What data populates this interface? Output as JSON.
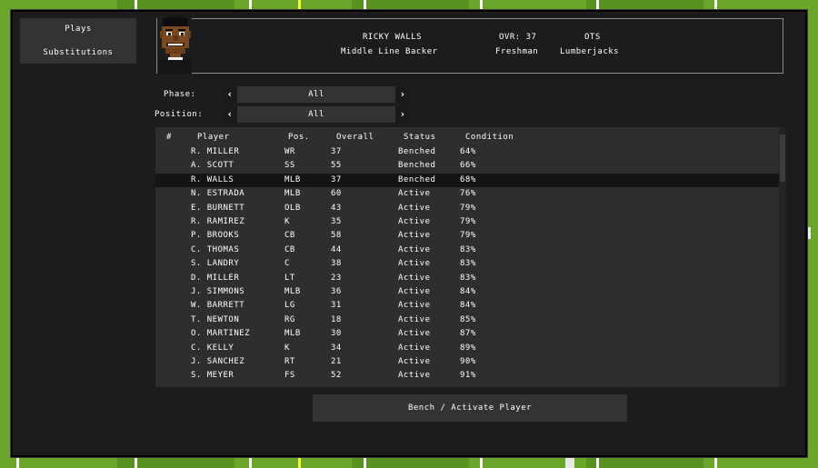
{
  "menu": {
    "items": [
      {
        "label": "Plays"
      },
      {
        "label": "Substitutions"
      }
    ]
  },
  "selected_player": {
    "name": "RICKY WALLS",
    "position": "Middle Line Backer",
    "ovr_label": "OVR: 37",
    "class_year": "Freshman",
    "depth": "OTS",
    "team": "Lumberjacks"
  },
  "filters": {
    "phase": {
      "label": "Phase:",
      "value": "All"
    },
    "position": {
      "label": "Position:",
      "value": "All"
    }
  },
  "roster": {
    "columns": [
      "#",
      "Player",
      "Pos.",
      "Overall",
      "Status",
      "Condition"
    ],
    "selected_index": 2,
    "rows": [
      {
        "player": "R. MILLER",
        "pos": "WR",
        "overall": "37",
        "status": "Benched",
        "condition": "64%"
      },
      {
        "player": "A. SCOTT",
        "pos": "SS",
        "overall": "55",
        "status": "Benched",
        "condition": "66%"
      },
      {
        "player": "R. WALLS",
        "pos": "MLB",
        "overall": "37",
        "status": "Benched",
        "condition": "68%"
      },
      {
        "player": "N. ESTRADA",
        "pos": "MLB",
        "overall": "60",
        "status": "Active",
        "condition": "76%"
      },
      {
        "player": "E. BURNETT",
        "pos": "OLB",
        "overall": "43",
        "status": "Active",
        "condition": "79%"
      },
      {
        "player": "R. RAMIREZ",
        "pos": "K",
        "overall": "35",
        "status": "Active",
        "condition": "79%"
      },
      {
        "player": "P. BROOKS",
        "pos": "CB",
        "overall": "58",
        "status": "Active",
        "condition": "79%"
      },
      {
        "player": "C. THOMAS",
        "pos": "CB",
        "overall": "44",
        "status": "Active",
        "condition": "83%"
      },
      {
        "player": "S. LANDRY",
        "pos": "C",
        "overall": "38",
        "status": "Active",
        "condition": "83%"
      },
      {
        "player": "D. MILLER",
        "pos": "LT",
        "overall": "23",
        "status": "Active",
        "condition": "83%"
      },
      {
        "player": "J. SIMMONS",
        "pos": "MLB",
        "overall": "36",
        "status": "Active",
        "condition": "84%"
      },
      {
        "player": "W. BARRETT",
        "pos": "LG",
        "overall": "31",
        "status": "Active",
        "condition": "84%"
      },
      {
        "player": "T. NEWTON",
        "pos": "RG",
        "overall": "18",
        "status": "Active",
        "condition": "85%"
      },
      {
        "player": "O. MARTINEZ",
        "pos": "MLB",
        "overall": "30",
        "status": "Active",
        "condition": "87%"
      },
      {
        "player": "C. KELLY",
        "pos": "K",
        "overall": "34",
        "status": "Active",
        "condition": "89%"
      },
      {
        "player": "J. SANCHEZ",
        "pos": "RT",
        "overall": "21",
        "status": "Active",
        "condition": "90%"
      },
      {
        "player": "S. MEYER",
        "pos": "FS",
        "overall": "52",
        "status": "Active",
        "condition": "91%"
      }
    ]
  },
  "actions": {
    "bench_activate_label": "Bench / Activate Player"
  },
  "icons": {
    "prev": "chevron-left-icon",
    "next": "chevron-right-icon"
  },
  "colors": {
    "field_light": "#6aa629",
    "field_dark": "#58921f",
    "panel": "#1c1c1c",
    "control": "#333333",
    "selected_row": "#141414"
  }
}
